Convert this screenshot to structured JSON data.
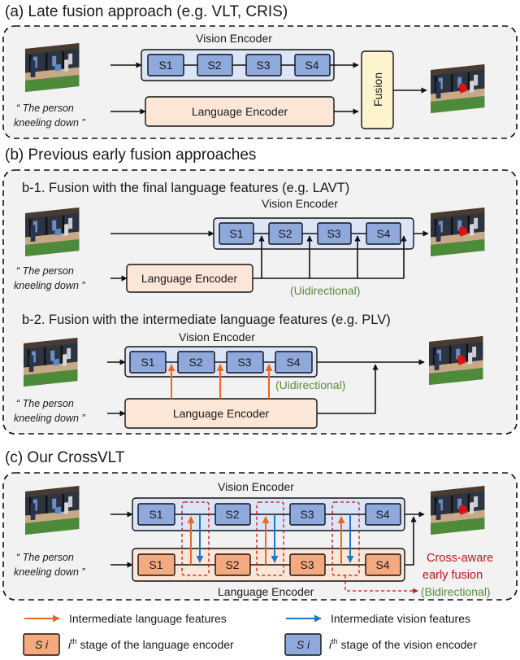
{
  "colors": {
    "panel_bg": "#f2f2f2",
    "vision_stage": "#8fa9dc",
    "vision_container": "#dbe5f7",
    "language_stage": "#f4a97f",
    "language_container": "#fce6d8",
    "fusion_box": "#fdf3cc",
    "orange_arrow": "#f26522",
    "blue_arrow": "#1f77c8",
    "red_dashed": "#c0171c",
    "green_text": "#5a8a3a",
    "segmentation_mask": "#e01010"
  },
  "query_text": [
    "“ The person",
    "kneeling down ”"
  ],
  "sections": {
    "a": {
      "title": "(a) Late fusion approach (e.g. VLT, CRIS)",
      "vision_label": "Vision Encoder",
      "stages": [
        "S1",
        "S2",
        "S3",
        "S4"
      ],
      "language_label": "Language Encoder",
      "fusion_label": "Fusion"
    },
    "b": {
      "title": "(b) Previous early fusion approaches",
      "b1": {
        "title": "b-1. Fusion with the final language features (e.g. LAVT)",
        "vision_label": "Vision Encoder",
        "stages": [
          "S1",
          "S2",
          "S3",
          "S4"
        ],
        "language_label": "Language Encoder",
        "direction_label": "(Uidirectional)"
      },
      "b2": {
        "title": "b-2. Fusion with the intermediate language features (e.g. PLV)",
        "vision_label": "Vision Encoder",
        "stages": [
          "S1",
          "S2",
          "S3",
          "S4"
        ],
        "language_label": "Language Encoder",
        "direction_label": "(Uidirectional)"
      }
    },
    "c": {
      "title": "(c) Our CrossVLT",
      "vision_label": "Vision Encoder",
      "vision_stages": [
        "S1",
        "S2",
        "S3",
        "S4"
      ],
      "language_stages": [
        "S1",
        "S2",
        "S3",
        "S4"
      ],
      "language_label": "Language Encoder",
      "callout_line1": "Cross-aware",
      "callout_line2": "early fusion",
      "direction_label": "(Bidirectional)"
    }
  },
  "legend": {
    "orange_arrow_label": "Intermediate language features",
    "blue_arrow_label": "Intermediate vision features",
    "lang_stage_symbol": "S i",
    "lang_stage_label_sup": "i",
    "lang_stage_label_sup2": "th",
    "lang_stage_label": " stage of the language encoder",
    "vision_stage_symbol": "S i",
    "vision_stage_label_sup": "i",
    "vision_stage_label_sup2": "th",
    "vision_stage_label": " stage of the vision encoder"
  }
}
